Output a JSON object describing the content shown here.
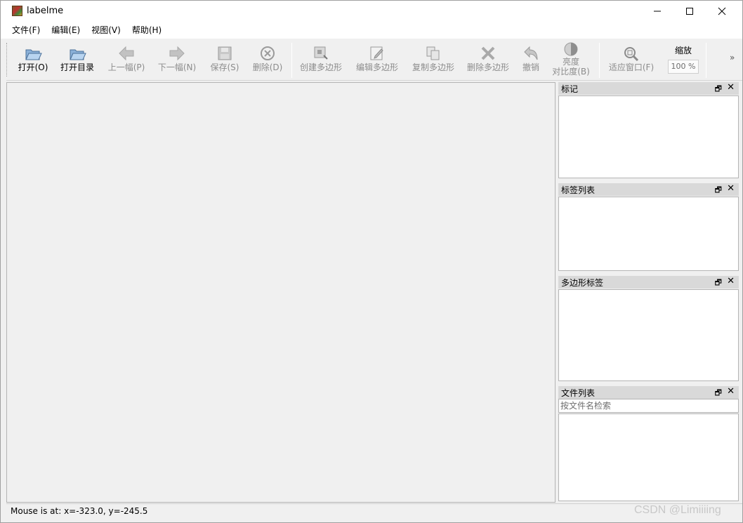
{
  "window": {
    "title": "labelme"
  },
  "menu": [
    {
      "label": "文件(F)"
    },
    {
      "label": "编辑(E)"
    },
    {
      "label": "视图(V)"
    },
    {
      "label": "帮助(H)"
    }
  ],
  "toolbar": {
    "open": "打开(O)",
    "open_dir": "打开目录",
    "prev": "上一幅(P)",
    "next": "下一幅(N)",
    "save": "保存(S)",
    "delete_file": "删除(D)",
    "create_polygon": "创建多边形",
    "edit_polygon": "编辑多边形",
    "copy_polygon": "复制多边形",
    "delete_polygon": "删除多边形",
    "undo": "撤销",
    "brightness_line1": "亮度",
    "brightness_line2": "对比度(B)",
    "fit_window": "适应窗口(F)",
    "zoom_label": "缩放",
    "zoom_value": "100 %",
    "overflow": "»"
  },
  "docks": {
    "flags": {
      "title": "标记"
    },
    "label_list": {
      "title": "标签列表"
    },
    "polygon_labels": {
      "title": "多边形标签"
    },
    "file_list": {
      "title": "文件列表",
      "search_placeholder": "按文件名检索"
    }
  },
  "status": {
    "text": "Mouse is at: x=-323.0, y=-245.5"
  },
  "watermark": "CSDN @Limiiiing",
  "colors": {
    "chrome": "#f0f0f0",
    "dock_header": "#d9d9d9",
    "disabled_text": "#8c8c8c"
  },
  "icons": [
    "folder-open-icon",
    "folder-icon",
    "arrow-left-icon",
    "arrow-right-icon",
    "floppy-icon",
    "circle-x-icon",
    "polygon-create-icon",
    "polygon-edit-icon",
    "polygon-copy-icon",
    "x-icon",
    "undo-icon",
    "brightness-icon",
    "zoom-fit-icon"
  ]
}
